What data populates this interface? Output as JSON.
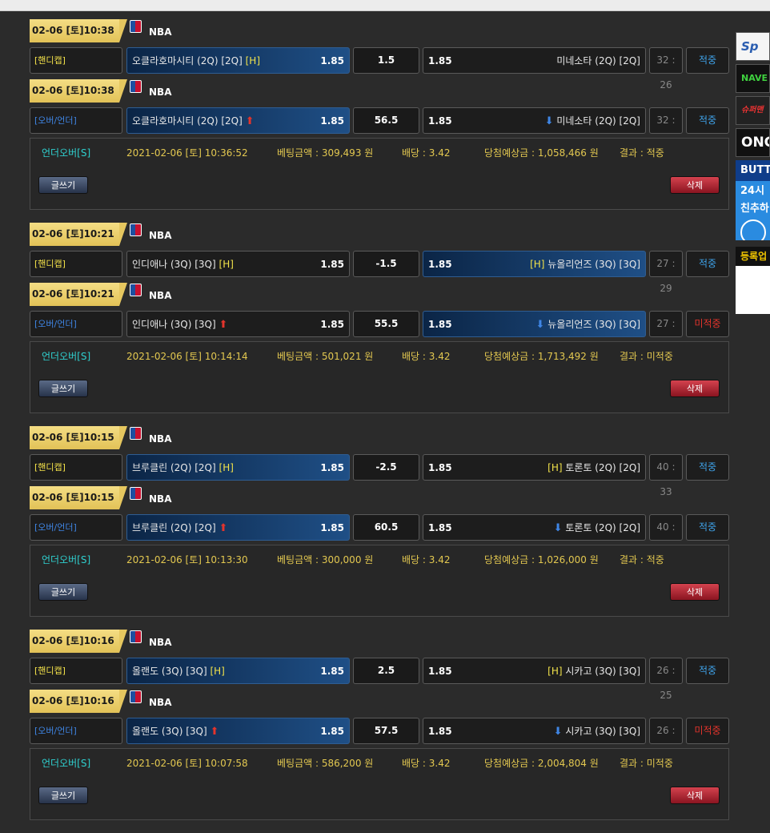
{
  "labels": {
    "handicap": "[핸디캡]",
    "over_under": "[오버/언더]",
    "league": "NBA",
    "write_button": "글쓰기",
    "delete_button": "삭제",
    "home_mark": "[H]"
  },
  "groups": [
    {
      "rows": [
        {
          "date": "02-06 [토]10:38",
          "type": "[핸디캡]",
          "home": "오클라호마시티 (2Q) [2Q]",
          "home_odds": "1.85",
          "line": "1.5",
          "away_odds": "1.85",
          "away": "미네소타 (2Q) [2Q]",
          "score": "32 : 26",
          "result": "적중"
        },
        {
          "date": "02-06 [토]10:38",
          "type": "[오버/언더]",
          "home": "오클라호마시티 (2Q) [2Q]",
          "home_odds": "1.85",
          "line": "56.5",
          "away_odds": "1.85",
          "away": "미네소타 (2Q) [2Q]",
          "score": "32 : 26",
          "result": "적중"
        }
      ],
      "bet": {
        "type": "언더오버[S]",
        "time": "2021-02-06 [토] 10:36:52",
        "amount": "베팅금액 : 309,493 원",
        "rate": "배당 : 3.42",
        "expected": "당첨예상금 : 1,058,466 원",
        "result": "결과 : 적중"
      }
    },
    {
      "rows": [
        {
          "date": "02-06 [토]10:21",
          "type": "[핸디캡]",
          "home": "인디애나 (3Q) [3Q]",
          "home_odds": "1.85",
          "line": "-1.5",
          "away_odds": "1.85",
          "away": "뉴올리언즈 (3Q) [3Q]",
          "score": "27 : 29",
          "result": "적중"
        },
        {
          "date": "02-06 [토]10:21",
          "type": "[오버/언더]",
          "home": "인디애나 (3Q) [3Q]",
          "home_odds": "1.85",
          "line": "55.5",
          "away_odds": "1.85",
          "away": "뉴올리언즈 (3Q) [3Q]",
          "score": "27 : 29",
          "result": "미적중"
        }
      ],
      "bet": {
        "type": "언더오버[S]",
        "time": "2021-02-06 [토] 10:14:14",
        "amount": "베팅금액 : 501,021 원",
        "rate": "배당 : 3.42",
        "expected": "당첨예상금 : 1,713,492 원",
        "result": "결과 : 미적중"
      }
    },
    {
      "rows": [
        {
          "date": "02-06 [토]10:15",
          "type": "[핸디캡]",
          "home": "브루클린 (2Q) [2Q]",
          "home_odds": "1.85",
          "line": "-2.5",
          "away_odds": "1.85",
          "away": "토론토 (2Q) [2Q]",
          "score": "40 : 33",
          "result": "적중"
        },
        {
          "date": "02-06 [토]10:15",
          "type": "[오버/언더]",
          "home": "브루클린 (2Q) [2Q]",
          "home_odds": "1.85",
          "line": "60.5",
          "away_odds": "1.85",
          "away": "토론토 (2Q) [2Q]",
          "score": "40 : 33",
          "result": "적중"
        }
      ],
      "bet": {
        "type": "언더오버[S]",
        "time": "2021-02-06 [토] 10:13:30",
        "amount": "베팅금액 : 300,000 원",
        "rate": "배당 : 3.42",
        "expected": "당첨예상금 : 1,026,000 원",
        "result": "결과 : 적중"
      }
    },
    {
      "rows": [
        {
          "date": "02-06 [토]10:16",
          "type": "[핸디캡]",
          "home": "올랜도 (3Q) [3Q]",
          "home_odds": "1.85",
          "line": "2.5",
          "away_odds": "1.85",
          "away": "시카고 (3Q) [3Q]",
          "score": "26 : 25",
          "result": "적중"
        },
        {
          "date": "02-06 [토]10:16",
          "type": "[오버/언더]",
          "home": "올랜도 (3Q) [3Q]",
          "home_odds": "1.85",
          "line": "57.5",
          "away_odds": "1.85",
          "away": "시카고 (3Q) [3Q]",
          "score": "26 : 25",
          "result": "미적중"
        }
      ],
      "bet": {
        "type": "언더오버[S]",
        "time": "2021-02-06 [토] 10:07:58",
        "amount": "베팅금액 : 586,200 원",
        "rate": "배당 : 3.42",
        "expected": "당첨예상금 : 2,004,804 원",
        "result": "결과 : 미적중"
      }
    }
  ],
  "sidebar": {
    "ads": [
      "Sp",
      "NAVE",
      "슈퍼맨",
      "ONG",
      "BUTT",
      "24시 친추하",
      "등록업"
    ]
  },
  "colors": {
    "date_badge": "#e6c75f",
    "selected_team": "#1f4f86",
    "win": "#3fa3ea",
    "lose": "#e3342c",
    "handicap": "#f5e34a",
    "over_under": "#3f86e6",
    "bet_label": "#e3c850",
    "bet_type": "#2fd0cf"
  },
  "icons": {
    "league": "nba-logo-icon",
    "over": "arrow-up-icon",
    "under": "arrow-down-icon"
  }
}
